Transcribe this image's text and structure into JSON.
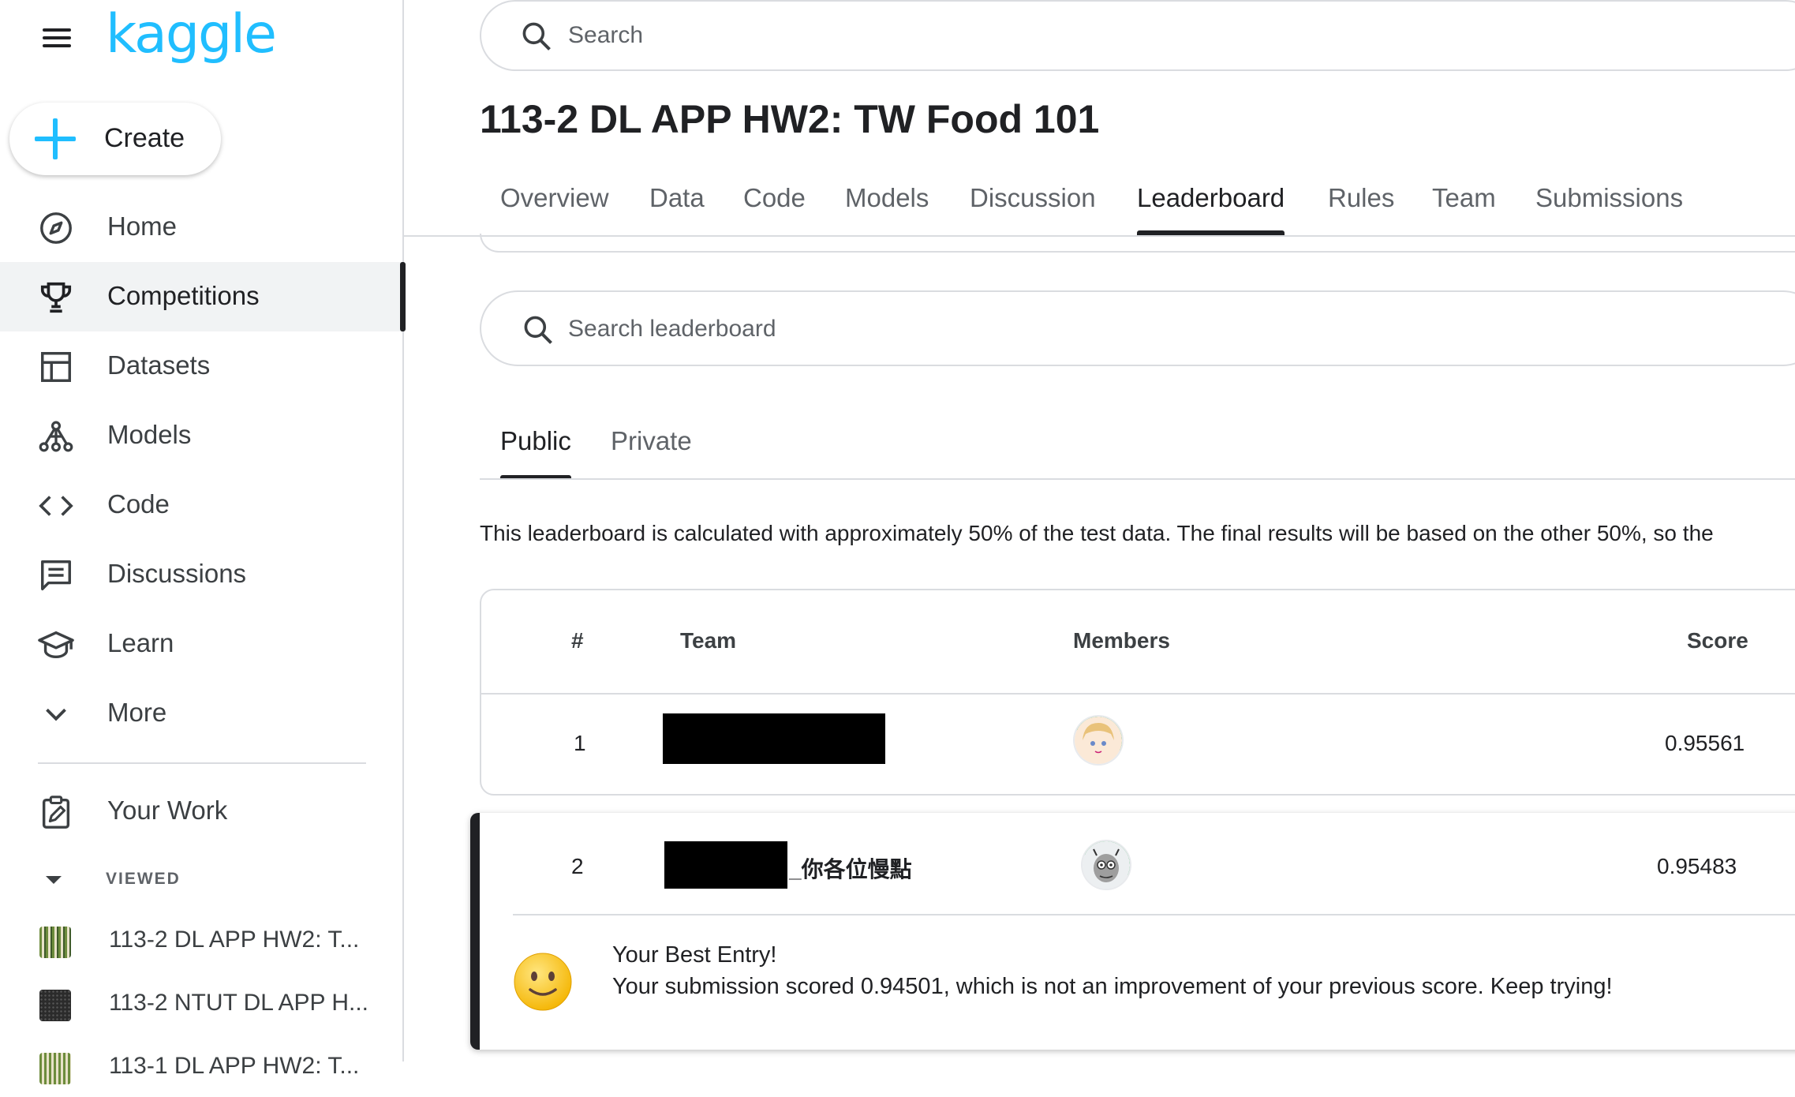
{
  "sidebar": {
    "logo": "kaggle",
    "create_label": "Create",
    "items": [
      {
        "label": "Home",
        "icon": "compass-icon"
      },
      {
        "label": "Competitions",
        "icon": "trophy-icon",
        "active": true
      },
      {
        "label": "Datasets",
        "icon": "table-icon"
      },
      {
        "label": "Models",
        "icon": "models-icon"
      },
      {
        "label": "Code",
        "icon": "code-icon"
      },
      {
        "label": "Discussions",
        "icon": "comments-icon"
      },
      {
        "label": "Learn",
        "icon": "school-icon"
      },
      {
        "label": "More",
        "icon": "chevron-down-icon"
      }
    ],
    "your_work_label": "Your Work",
    "viewed_label": "VIEWED",
    "recent": [
      {
        "label": "113-2 DL APP HW2: T..."
      },
      {
        "label": "113-2 NTUT DL APP H..."
      },
      {
        "label": "113-1 DL APP HW2: T..."
      }
    ]
  },
  "header": {
    "search_placeholder": "Search"
  },
  "competition": {
    "title": "113-2 DL APP HW2: TW Food 101",
    "tabs": [
      "Overview",
      "Data",
      "Code",
      "Models",
      "Discussion",
      "Leaderboard",
      "Rules",
      "Team",
      "Submissions"
    ],
    "active_tab": "Leaderboard"
  },
  "leaderboard": {
    "search_placeholder": "Search leaderboard",
    "subtabs": [
      "Public",
      "Private"
    ],
    "active_subtab": "Public",
    "notice": "This leaderboard is calculated with approximately 50% of the test data. The final results will be based on the other 50%, so the",
    "columns": [
      "#",
      "Team",
      "Members",
      "Score"
    ],
    "rows": [
      {
        "rank": "1",
        "team": "",
        "score": "0.95561"
      },
      {
        "rank": "2",
        "team": "_你各位慢點",
        "score": "0.95483"
      }
    ],
    "best_entry_title": "Your Best Entry!",
    "best_entry_message": "Your submission scored 0.94501, which is not an improvement of your previous score. Keep trying!"
  },
  "colors": {
    "brand": "#20BEFF",
    "text": "#202124",
    "muted": "#5f6368",
    "border": "#dadce0"
  }
}
